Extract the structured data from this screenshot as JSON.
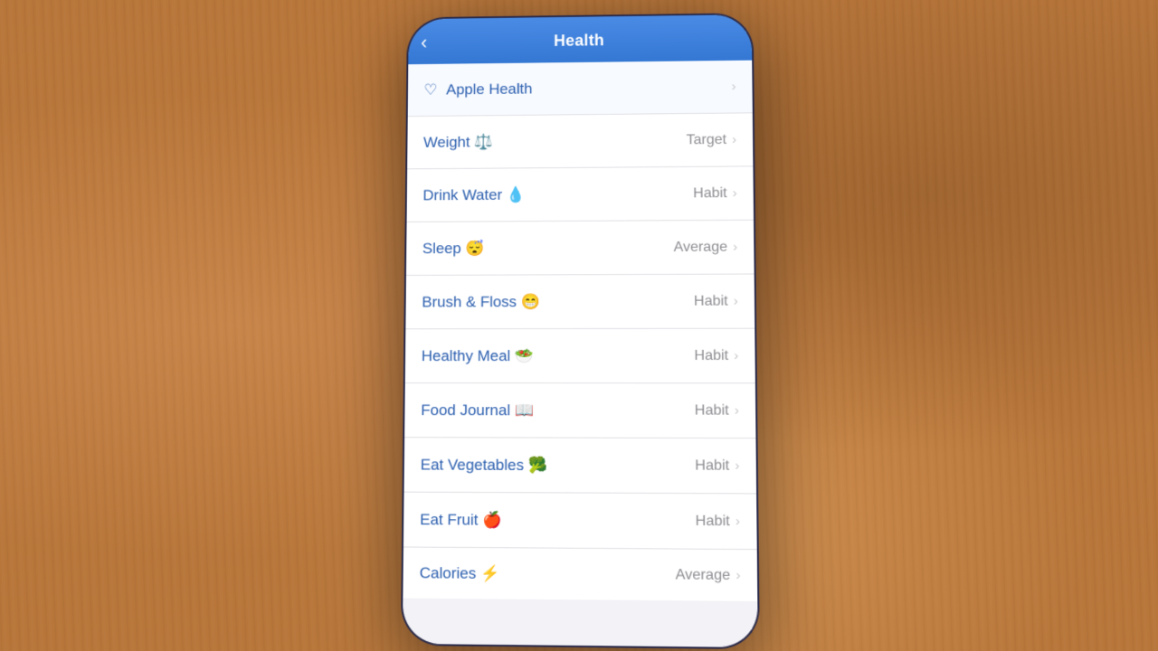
{
  "nav": {
    "title": "Health",
    "back_icon": "‹"
  },
  "items": [
    {
      "id": "apple-health",
      "icon": "♡",
      "title": "Apple Health",
      "badge": "",
      "chevron": "›",
      "special": true
    },
    {
      "id": "weight",
      "icon": "",
      "title": "Weight ⚖️",
      "badge": "Target",
      "chevron": "›"
    },
    {
      "id": "drink-water",
      "icon": "",
      "title": "Drink Water 💧",
      "badge": "Habit",
      "chevron": "›"
    },
    {
      "id": "sleep",
      "icon": "",
      "title": "Sleep 😴",
      "badge": "Average",
      "chevron": "›"
    },
    {
      "id": "brush-floss",
      "icon": "",
      "title": "Brush & Floss 😁",
      "badge": "Habit",
      "chevron": "›"
    },
    {
      "id": "healthy-meal",
      "icon": "",
      "title": "Healthy Meal 🥗",
      "badge": "Habit",
      "chevron": "›"
    },
    {
      "id": "food-journal",
      "icon": "",
      "title": "Food Journal 📖",
      "badge": "Habit",
      "chevron": "›"
    },
    {
      "id": "eat-vegetables",
      "icon": "",
      "title": "Eat Vegetables 🥦",
      "badge": "Habit",
      "chevron": "›"
    },
    {
      "id": "eat-fruit",
      "icon": "",
      "title": "Eat Fruit 🍎",
      "badge": "Habit",
      "chevron": "›"
    },
    {
      "id": "calories",
      "icon": "",
      "title": "Calories ⚡",
      "badge": "Average",
      "chevron": "›",
      "partial": true
    }
  ]
}
